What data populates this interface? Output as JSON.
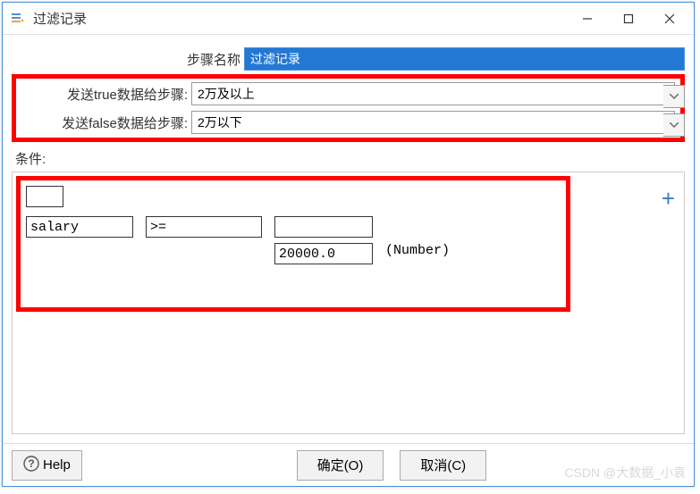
{
  "window": {
    "title": "过滤记录"
  },
  "form": {
    "step_name_label": "步骤名称",
    "step_name_value": "过滤记录",
    "send_true_label": "发送true数据给步骤:",
    "send_true_value": "2万及以上",
    "send_false_label": "发送false数据给步骤:",
    "send_false_value": "2万以下"
  },
  "conditions": {
    "label": "条件:",
    "row": {
      "field": "salary",
      "operator": ">=",
      "value_top": "",
      "value": "20000.0",
      "type": "(Number)"
    }
  },
  "footer": {
    "help": "Help",
    "ok": "确定(O)",
    "cancel": "取消(C)"
  },
  "watermark": "CSDN @大数据_小袁"
}
